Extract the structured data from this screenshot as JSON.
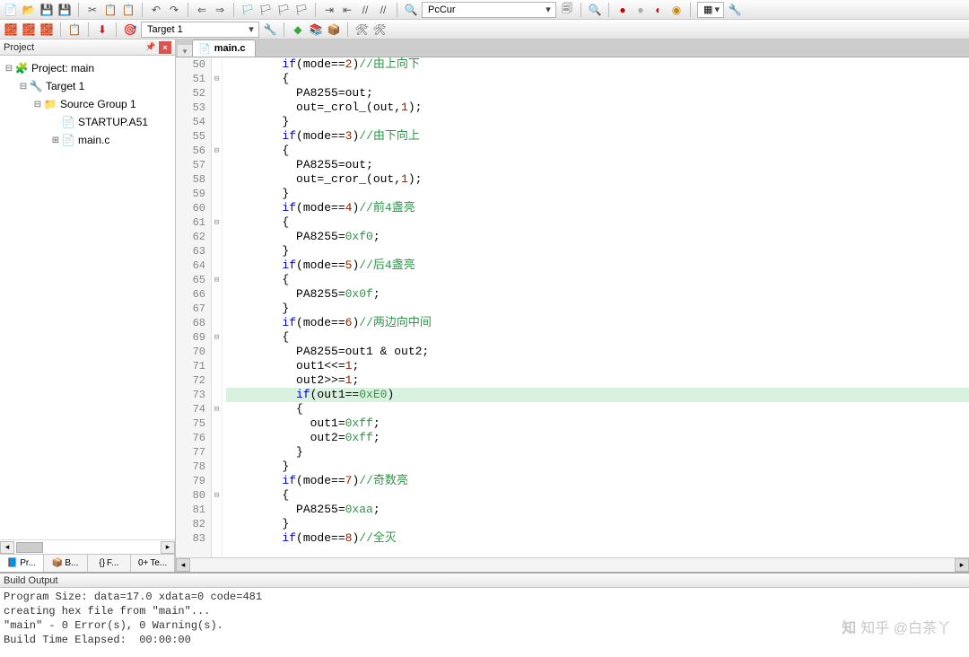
{
  "toolbar": {
    "search_box": "PcCur",
    "target": "Target 1"
  },
  "project_panel": {
    "title": "Project",
    "tree": [
      {
        "level": 0,
        "exp": "-",
        "icon": "🧩",
        "label": "Project: main"
      },
      {
        "level": 1,
        "exp": "-",
        "icon": "🔧",
        "label": "Target 1"
      },
      {
        "level": 2,
        "exp": "-",
        "icon": "📁",
        "label": "Source Group 1"
      },
      {
        "level": 3,
        "exp": "",
        "icon": "📄",
        "label": "STARTUP.A51"
      },
      {
        "level": 3,
        "exp": "+",
        "icon": "📄",
        "label": "main.c"
      }
    ],
    "tabs": [
      {
        "icon": "📘",
        "label": "Pr...",
        "active": true
      },
      {
        "icon": "📦",
        "label": "B..."
      },
      {
        "icon": "{}",
        "label": "F..."
      },
      {
        "icon": "0+",
        "label": "Te..."
      }
    ]
  },
  "editor": {
    "tab_label": "main.c",
    "lines": [
      {
        "n": 50,
        "fold": "",
        "kind": "if_cmt",
        "cond": "mode==2",
        "cmt": "//由上向下"
      },
      {
        "n": 51,
        "fold": "-",
        "kind": "brace_open_2"
      },
      {
        "n": 52,
        "fold": "",
        "kind": "assign",
        "lhs": "PA8255",
        "rhs": "out"
      },
      {
        "n": 53,
        "fold": "",
        "kind": "call",
        "txt": "out=_crol_(out,",
        "num": "1",
        "tail": ");"
      },
      {
        "n": 54,
        "fold": "",
        "kind": "brace_close_2"
      },
      {
        "n": 55,
        "fold": "",
        "kind": "if_cmt",
        "cond": "mode==3",
        "cmt": "//由下向上"
      },
      {
        "n": 56,
        "fold": "-",
        "kind": "brace_open_2"
      },
      {
        "n": 57,
        "fold": "",
        "kind": "assign",
        "lhs": "PA8255",
        "rhs": "out"
      },
      {
        "n": 58,
        "fold": "",
        "kind": "call",
        "txt": "out=_cror_(out,",
        "num": "1",
        "tail": ");"
      },
      {
        "n": 59,
        "fold": "",
        "kind": "brace_close_2"
      },
      {
        "n": 60,
        "fold": "",
        "kind": "if_cmt",
        "cond": "mode==4",
        "cmt": "//前4盏亮"
      },
      {
        "n": 61,
        "fold": "-",
        "kind": "brace_open_2"
      },
      {
        "n": 62,
        "fold": "",
        "kind": "assign_hex",
        "lhs": "PA8255",
        "hex": "0xf0"
      },
      {
        "n": 63,
        "fold": "",
        "kind": "brace_close_2"
      },
      {
        "n": 64,
        "fold": "",
        "kind": "if_cmt",
        "cond": "mode==5",
        "cmt": "//后4盏亮"
      },
      {
        "n": 65,
        "fold": "-",
        "kind": "brace_open_2"
      },
      {
        "n": 66,
        "fold": "",
        "kind": "assign_hex",
        "lhs": "PA8255",
        "hex": "0x0f"
      },
      {
        "n": 67,
        "fold": "",
        "kind": "brace_close_2"
      },
      {
        "n": 68,
        "fold": "",
        "kind": "if_cmt",
        "cond": "mode==6",
        "cmt": "//两边向中间"
      },
      {
        "n": 69,
        "fold": "-",
        "kind": "brace_open_2"
      },
      {
        "n": 70,
        "fold": "",
        "kind": "plain",
        "txt": "PA8255=out1 & out2;"
      },
      {
        "n": 71,
        "fold": "",
        "kind": "shift",
        "lhs": "out1",
        "op": "<<=",
        "num": "1"
      },
      {
        "n": 72,
        "fold": "",
        "kind": "shift",
        "lhs": "out2",
        "op": ">>=",
        "num": "1"
      },
      {
        "n": 73,
        "fold": "",
        "kind": "if_hex_hl",
        "var": "out1",
        "hex": "0xE0",
        "hl": true
      },
      {
        "n": 74,
        "fold": "-",
        "kind": "brace_open_3"
      },
      {
        "n": 75,
        "fold": "",
        "kind": "assign_hex_i",
        "lhs": "out1",
        "hex": "0xff"
      },
      {
        "n": 76,
        "fold": "",
        "kind": "assign_hex_i",
        "lhs": "out2",
        "hex": "0xff"
      },
      {
        "n": 77,
        "fold": "",
        "kind": "brace_close_3"
      },
      {
        "n": 78,
        "fold": "",
        "kind": "brace_close_2"
      },
      {
        "n": 79,
        "fold": "",
        "kind": "if_cmt",
        "cond": "mode==7",
        "cmt": "//奇数亮"
      },
      {
        "n": 80,
        "fold": "-",
        "kind": "brace_open_2"
      },
      {
        "n": 81,
        "fold": "",
        "kind": "assign_hex",
        "lhs": "PA8255",
        "hex": "0xaa"
      },
      {
        "n": 82,
        "fold": "",
        "kind": "brace_close_2"
      },
      {
        "n": 83,
        "fold": "",
        "kind": "if_cmt",
        "cond": "mode==8",
        "cmt": "//全灭"
      }
    ]
  },
  "build": {
    "title": "Build Output",
    "lines": [
      "Program Size: data=17.0 xdata=0 code=481",
      "creating hex file from \"main\"...",
      "\"main\" - 0 Error(s), 0 Warning(s).",
      "Build Time Elapsed:  00:00:00"
    ]
  },
  "watermark": "知乎 @白茶丫"
}
